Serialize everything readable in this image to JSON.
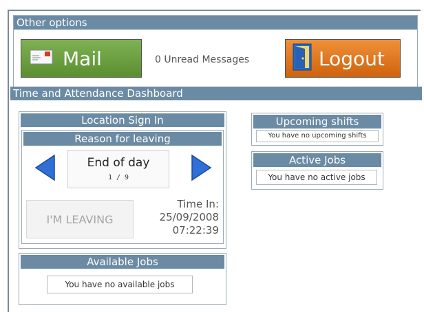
{
  "other_options": {
    "title": "Other options",
    "mail_label": "Mail",
    "unread_text": "0 Unread Messages",
    "logout_label": "Logout"
  },
  "dashboard": {
    "title": "Time and Attendance Dashboard"
  },
  "location": {
    "title": "Location Sign In",
    "reason_title": "Reason for leaving",
    "reason_value": "End of day",
    "reason_counter": "1 / 9",
    "leaving_label": "I'M LEAVING",
    "time_in_label": "Time In:",
    "time_in_date": "25/09/2008",
    "time_in_time": "07:22:39"
  },
  "available_jobs": {
    "title": "Available Jobs",
    "message": "You have no available jobs"
  },
  "upcoming_shifts": {
    "title": "Upcoming shifts",
    "message": "You have no upcoming shifts"
  },
  "active_jobs": {
    "title": "Active Jobs",
    "message": "You have no active jobs"
  },
  "icons": {
    "mail": "envelope-icon",
    "logout": "door-icon",
    "prev": "arrow-left-icon",
    "next": "arrow-right-icon"
  },
  "colors": {
    "header_bar": "#6b8ba4",
    "mail_button": "#6a9e3f",
    "logout_button": "#e4761f",
    "arrow": "#2f6fd6"
  }
}
